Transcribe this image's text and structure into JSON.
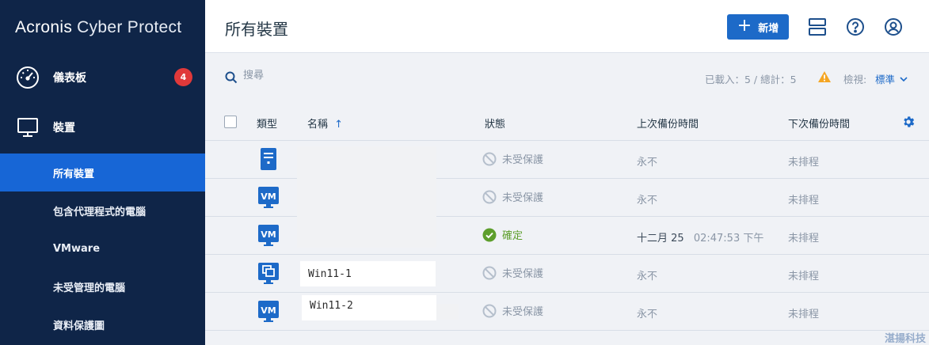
{
  "app": {
    "brand_primary": "Acronis",
    "brand_secondary": "Cyber Protect"
  },
  "sidebar": {
    "main_items": [
      {
        "label": "儀表板",
        "icon": "gauge-icon",
        "badge": "4"
      },
      {
        "label": "裝置",
        "icon": "monitor-icon"
      }
    ],
    "sub_items": [
      {
        "label": "所有裝置",
        "active": true
      },
      {
        "label": "包含代理程式的電腦"
      },
      {
        "label": "VMware"
      },
      {
        "label": "未受管理的電腦"
      },
      {
        "label": "資料保護圖"
      }
    ]
  },
  "header": {
    "title": "所有裝置",
    "add_label": "新增"
  },
  "toolbar": {
    "search_placeholder": "搜尋",
    "loaded_info": "已載入：5 / 總計：5",
    "view_label": "檢視:",
    "view_value": "標準"
  },
  "table": {
    "columns": {
      "type": "類型",
      "name": "名稱",
      "status": "狀態",
      "last_backup": "上次備份時間",
      "next_backup": "下次備份時間"
    },
    "rows": [
      {
        "type_icon": "server-icon",
        "name": "",
        "status": "未受保護",
        "status_ok": false,
        "last_backup_date": "永不",
        "last_backup_time": "",
        "next_backup": "未排程"
      },
      {
        "type_icon": "vm-icon",
        "name": "",
        "status": "未受保護",
        "status_ok": false,
        "last_backup_date": "永不",
        "last_backup_time": "",
        "next_backup": "未排程"
      },
      {
        "type_icon": "vm-icon",
        "name": "",
        "status": "確定",
        "status_ok": true,
        "last_backup_date": "十二月 25",
        "last_backup_time": "02:47:53 下午",
        "next_backup": "未排程"
      },
      {
        "type_icon": "vm-group-icon",
        "name": "Win11-1",
        "status": "未受保護",
        "status_ok": false,
        "last_backup_date": "永不",
        "last_backup_time": "",
        "next_backup": "未排程"
      },
      {
        "type_icon": "vm-icon",
        "name": "Win11-2",
        "status": "未受保護",
        "status_ok": false,
        "last_backup_date": "永不",
        "last_backup_time": "",
        "next_backup": "未排程"
      }
    ]
  },
  "watermark": "湛揚科技",
  "colors": {
    "sidebar_bg": "#0f2548",
    "active_item": "#1766d6",
    "accent": "#1d6ac8",
    "badge": "#e0393a",
    "ok_green": "#5d9e2c",
    "warning": "#f5a623"
  }
}
